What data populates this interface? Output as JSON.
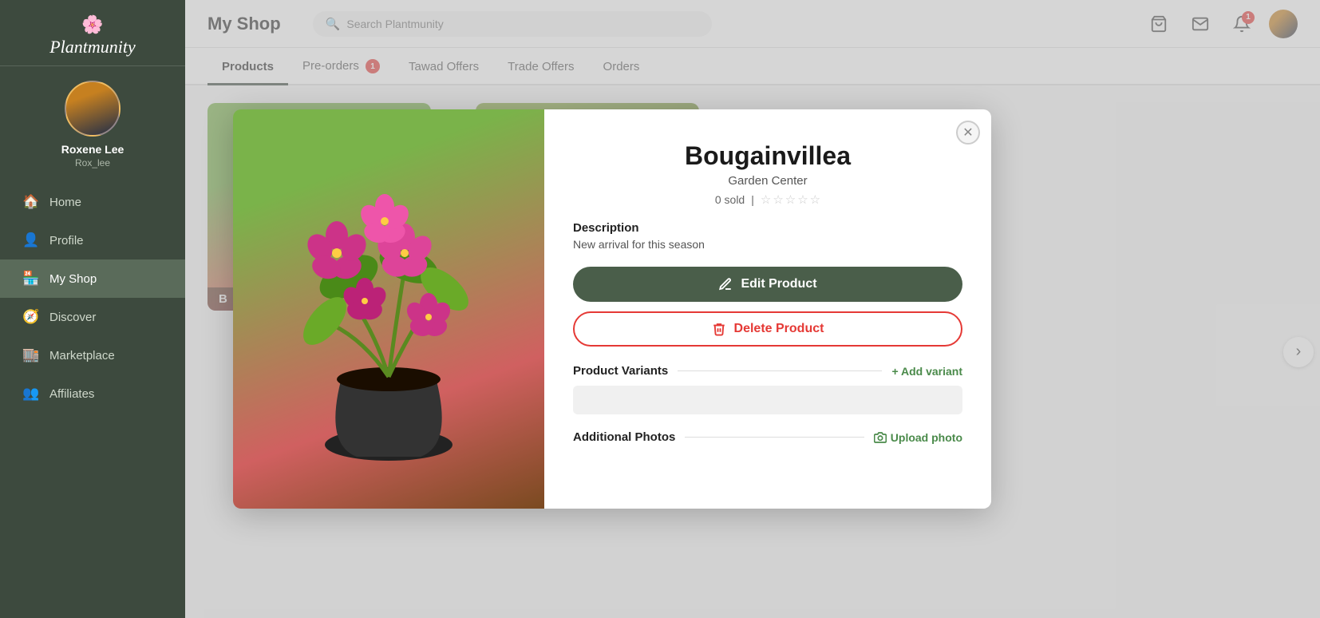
{
  "sidebar": {
    "logo_text": "Plantmunity",
    "username": "Roxene Lee",
    "handle": "Rox_lee",
    "nav_items": [
      {
        "id": "home",
        "label": "Home",
        "icon": "🏠",
        "active": false
      },
      {
        "id": "profile",
        "label": "Profile",
        "icon": "👤",
        "active": false
      },
      {
        "id": "myshop",
        "label": "My Shop",
        "icon": "🏪",
        "active": true
      },
      {
        "id": "discover",
        "label": "Discover",
        "icon": "🧭",
        "active": false
      },
      {
        "id": "marketplace",
        "label": "Marketplace",
        "icon": "🏬",
        "active": false
      },
      {
        "id": "affiliates",
        "label": "Affiliates",
        "icon": "👥",
        "active": false
      }
    ]
  },
  "topbar": {
    "title": "My Shop",
    "search_placeholder": "Search Plantmunity",
    "notif_count": "1"
  },
  "tabs": [
    {
      "id": "products",
      "label": "Products",
      "active": true,
      "badge": null
    },
    {
      "id": "preorders",
      "label": "Pre-orders",
      "active": false,
      "badge": "1"
    },
    {
      "id": "tawad",
      "label": "Tawad Offers",
      "active": false,
      "badge": null
    },
    {
      "id": "trade",
      "label": "Trade Offers",
      "active": false,
      "badge": null
    },
    {
      "id": "orders",
      "label": "Orders",
      "active": false,
      "badge": null
    }
  ],
  "modal": {
    "product_name": "Bougainvillea",
    "shop_name": "Garden Center",
    "sold_count": "0 sold",
    "stars": [
      false,
      false,
      false,
      false,
      false
    ],
    "description_label": "Description",
    "description_text": "New arrival for this season",
    "edit_button_label": "Edit Product",
    "delete_button_label": "Delete Product",
    "variants_label": "Product Variants",
    "add_variant_label": "+ Add variant",
    "photos_label": "Additional Photos",
    "upload_photo_label": "Upload photo",
    "image_overlay_label": "B",
    "close_icon": "✕"
  },
  "products_area": {
    "carousel_arrow": "›"
  }
}
